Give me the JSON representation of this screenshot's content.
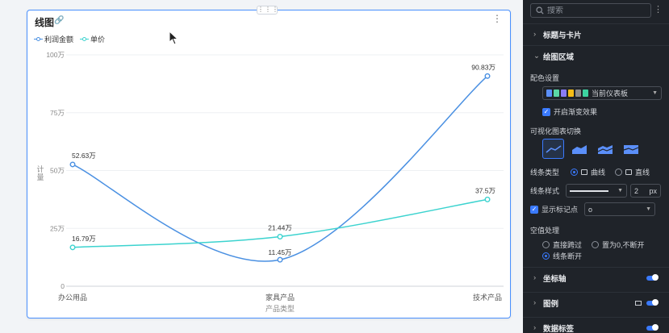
{
  "card": {
    "title": "线图",
    "legend": [
      {
        "name": "利润金额",
        "color": "#4a90e2"
      },
      {
        "name": "单价",
        "color": "#3cd3cf"
      }
    ]
  },
  "chart_data": {
    "type": "line",
    "categories": [
      "办公用品",
      "家具产品",
      "技术产品"
    ],
    "series": [
      {
        "name": "利润金额",
        "values": [
          52.63,
          11.45,
          90.83
        ],
        "labels": [
          "52.63万",
          "11.45万",
          "90.83万"
        ],
        "color": "#4a90e2"
      },
      {
        "name": "单价",
        "values": [
          16.79,
          21.44,
          37.5
        ],
        "labels": [
          "16.79万",
          "21.44万",
          "37.5万"
        ],
        "color": "#3cd3cf"
      }
    ],
    "ylim": [
      0,
      100
    ],
    "yticks": [
      0,
      25,
      50,
      75,
      100
    ],
    "ytick_labels": [
      "0",
      "25万",
      "50万",
      "75万",
      "100万"
    ],
    "xlabel": "产品类型",
    "ylabel": "计量",
    "smooth": true,
    "grid": true
  },
  "panel": {
    "search_placeholder": "搜索",
    "sections": {
      "title_card": "标题与卡片",
      "plot_area": "绘图区域",
      "axis": "坐标轴",
      "legend": "图例",
      "data_label": "数据标签"
    },
    "color_setting": {
      "label": "配色设置",
      "value": "当前仪表板",
      "swatches": [
        "#5b8ff9",
        "#5ad8a6",
        "#8b7cf6",
        "#f6bd16",
        "#8c8c8c",
        "#3cd3a0"
      ],
      "gradient_label": "开启渐变效果"
    },
    "chart_switch_label": "可视化图表切换",
    "line_type": {
      "label": "线条类型",
      "options": [
        "曲线",
        "直线"
      ],
      "selected": "曲线"
    },
    "line_style": {
      "label": "线条样式",
      "width": "2",
      "unit": "px"
    },
    "marker": {
      "label": "显示标记点",
      "value": "o"
    },
    "null_handling": {
      "label": "空值处理",
      "options": [
        "直接跨过",
        "置为0,不断开",
        "线条断开"
      ],
      "selected": "线条断开"
    }
  }
}
